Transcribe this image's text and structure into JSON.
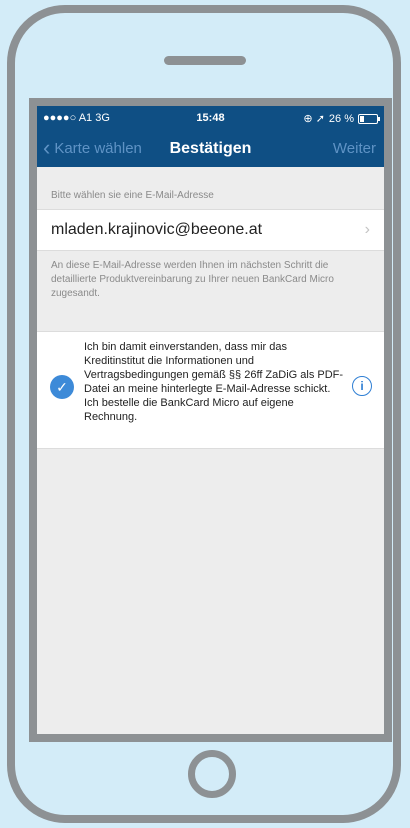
{
  "statusbar": {
    "signal": "●●●●○",
    "carrier": "A1",
    "network": "3G",
    "time": "15:48",
    "icons": "⊕ ➚",
    "battery": "26 %",
    "battery_level": 0.26
  },
  "navbar": {
    "back_label": "Karte wählen",
    "title": "Bestätigen",
    "next_label": "Weiter"
  },
  "email_section": {
    "caption": "Bitte wählen sie eine E-Mail-Adresse",
    "email": "mladen.krajinovic@beeone.at",
    "chevron": "›",
    "info": "An diese E-Mail-Adresse werden Ihnen im nächsten Schritt die detaillierte Produktvereinbarung zu Ihrer neuen BankCard Micro zugesandt."
  },
  "consent": {
    "checked": true,
    "text": "Ich bin damit einverstanden, dass mir das Kreditinstitut die Informationen und Vertragsbedingungen gemäß §§ 26ff ZaDiG als PDF-Datei an meine hinterlegte E-Mail-Adresse schickt. Ich bestelle die BankCard Micro auf eigene Rechnung.",
    "info_glyph": "i"
  },
  "colors": {
    "navbar": "#0f4f84",
    "accent": "#3d8ad8",
    "background": "#d3ecf8"
  }
}
